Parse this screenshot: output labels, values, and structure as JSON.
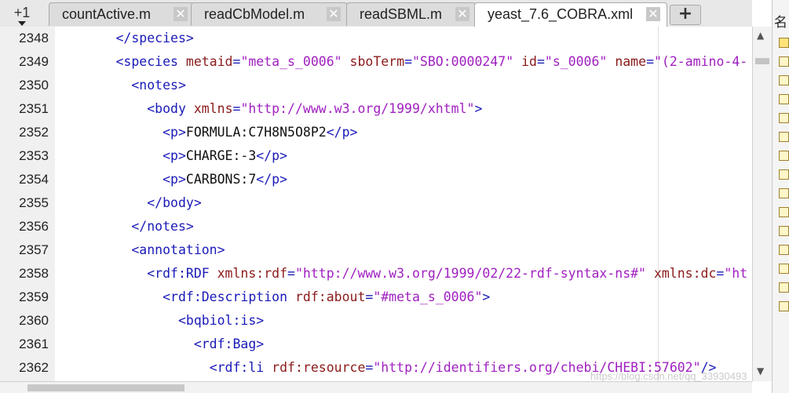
{
  "tabs": {
    "counter": "+1",
    "items": [
      {
        "label": "countActive.m",
        "active": false
      },
      {
        "label": "readCbModel.m",
        "active": false
      },
      {
        "label": "readSBML.m",
        "active": false
      },
      {
        "label": "yeast_7.6_COBRA.xml",
        "active": true
      }
    ],
    "close_symbol": "✕",
    "new_tab_symbol": "+"
  },
  "editor": {
    "lines": [
      {
        "num": "2348",
        "indent": "        ",
        "segments": [
          [
            "tag",
            "</species>"
          ]
        ]
      },
      {
        "num": "2349",
        "indent": "        ",
        "segments": [
          [
            "tag",
            "<species "
          ],
          [
            "attr",
            "metaid"
          ],
          [
            "tag",
            "="
          ],
          [
            "str",
            "\"meta_s_0006\""
          ],
          [
            "text",
            " "
          ],
          [
            "attr",
            "sboTerm"
          ],
          [
            "tag",
            "="
          ],
          [
            "str",
            "\"SBO:0000247\""
          ],
          [
            "text",
            " "
          ],
          [
            "attr",
            "id"
          ],
          [
            "tag",
            "="
          ],
          [
            "str",
            "\"s_0006\""
          ],
          [
            "text",
            " "
          ],
          [
            "attr",
            "name"
          ],
          [
            "tag",
            "="
          ],
          [
            "str",
            "\"(2-amino-4-"
          ]
        ]
      },
      {
        "num": "2350",
        "indent": "          ",
        "segments": [
          [
            "tag",
            "<notes>"
          ]
        ]
      },
      {
        "num": "2351",
        "indent": "            ",
        "segments": [
          [
            "tag",
            "<body "
          ],
          [
            "attr",
            "xmlns"
          ],
          [
            "tag",
            "="
          ],
          [
            "str",
            "\"http://www.w3.org/1999/xhtml\""
          ],
          [
            "tag",
            ">"
          ]
        ]
      },
      {
        "num": "2352",
        "indent": "              ",
        "segments": [
          [
            "tag",
            "<p>"
          ],
          [
            "text",
            "FORMULA:C7H8N5O8P2"
          ],
          [
            "tag",
            "</p>"
          ]
        ]
      },
      {
        "num": "2353",
        "indent": "              ",
        "segments": [
          [
            "tag",
            "<p>"
          ],
          [
            "text",
            "CHARGE:-3"
          ],
          [
            "tag",
            "</p>"
          ]
        ]
      },
      {
        "num": "2354",
        "indent": "              ",
        "segments": [
          [
            "tag",
            "<p>"
          ],
          [
            "text",
            "CARBONS:7"
          ],
          [
            "tag",
            "</p>"
          ]
        ]
      },
      {
        "num": "2355",
        "indent": "            ",
        "segments": [
          [
            "tag",
            "</body>"
          ]
        ]
      },
      {
        "num": "2356",
        "indent": "          ",
        "segments": [
          [
            "tag",
            "</notes>"
          ]
        ]
      },
      {
        "num": "2357",
        "indent": "          ",
        "segments": [
          [
            "tag",
            "<annotation>"
          ]
        ]
      },
      {
        "num": "2358",
        "indent": "            ",
        "segments": [
          [
            "tag",
            "<rdf:RDF "
          ],
          [
            "attr",
            "xmlns:rdf"
          ],
          [
            "tag",
            "="
          ],
          [
            "str",
            "\"http://www.w3.org/1999/02/22-rdf-syntax-ns#\""
          ],
          [
            "text",
            " "
          ],
          [
            "attr",
            "xmlns:dc"
          ],
          [
            "tag",
            "="
          ],
          [
            "str",
            "\"ht"
          ]
        ]
      },
      {
        "num": "2359",
        "indent": "              ",
        "segments": [
          [
            "tag",
            "<rdf:Description "
          ],
          [
            "attr",
            "rdf:about"
          ],
          [
            "tag",
            "="
          ],
          [
            "str",
            "\"#meta_s_0006\""
          ],
          [
            "tag",
            ">"
          ]
        ]
      },
      {
        "num": "2360",
        "indent": "                ",
        "segments": [
          [
            "tag",
            "<bqbiol:is>"
          ]
        ]
      },
      {
        "num": "2361",
        "indent": "                  ",
        "segments": [
          [
            "tag",
            "<rdf:Bag>"
          ]
        ]
      },
      {
        "num": "2362",
        "indent": "                    ",
        "segments": [
          [
            "tag",
            "<rdf:li "
          ],
          [
            "attr",
            "rdf:resource"
          ],
          [
            "tag",
            "="
          ],
          [
            "str",
            "\"http://identifiers.org/chebi/CHEBI:57602\""
          ],
          [
            "tag",
            "/>"
          ]
        ]
      }
    ]
  },
  "scrollbar": {
    "up_arrow": "▲",
    "down_arrow": "▼"
  },
  "side_panel": {
    "header_char": "名",
    "checked_first": true,
    "box_count": 15
  },
  "watermark": "https://blog.csdn.net/qq_33930493",
  "colors": {
    "tag": "#1a1ab8",
    "attribute": "#8b1a1a",
    "string": "#a020c0",
    "text": "#111111",
    "gutter": "#f0f0f0"
  }
}
